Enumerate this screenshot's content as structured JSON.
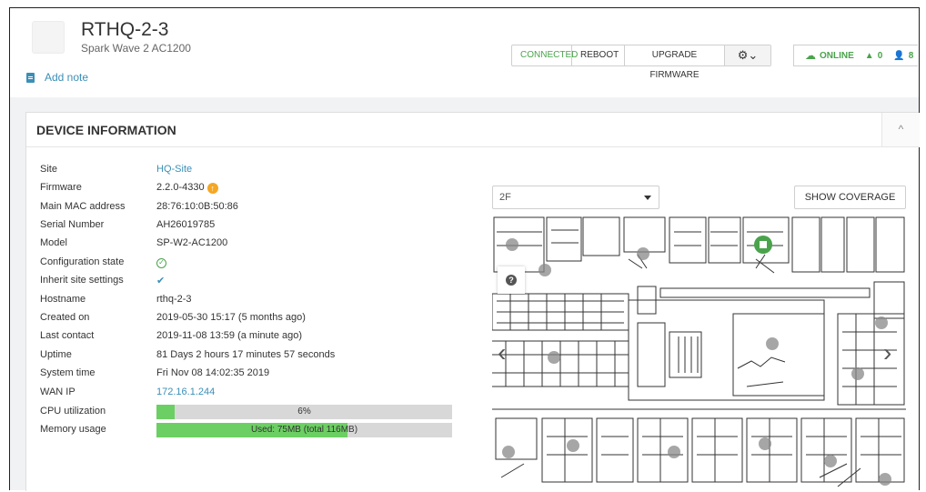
{
  "device": {
    "name": "RTHQ-2-3",
    "model_name": "Spark Wave 2 AC1200",
    "add_note": "Add note"
  },
  "actions": {
    "connected": "CONNECTED",
    "reboot": "REBOOT",
    "upgrade": "UPGRADE FIRMWARE",
    "gear": "⚙⌄"
  },
  "status": {
    "online": "ONLINE",
    "alerts": "0",
    "clients": "8"
  },
  "panel": {
    "title": "DEVICE INFORMATION",
    "collapse": "^"
  },
  "info": {
    "site": {
      "label": "Site",
      "value": "HQ-Site"
    },
    "firmware": {
      "label": "Firmware",
      "value": "2.2.0-4330"
    },
    "mac": {
      "label": "Main MAC address",
      "value": "28:76:10:0B:50:86"
    },
    "serial": {
      "label": "Serial Number",
      "value": "AH26019785"
    },
    "model": {
      "label": "Model",
      "value": "SP-W2-AC1200"
    },
    "config": {
      "label": "Configuration state"
    },
    "inherit": {
      "label": "Inherit site settings"
    },
    "hostname": {
      "label": "Hostname",
      "value": "rthq-2-3"
    },
    "created": {
      "label": "Created on",
      "value": "2019-05-30 15:17 (5 months ago)"
    },
    "last_contact": {
      "label": "Last contact",
      "value": "2019-11-08 13:59 (a minute ago)"
    },
    "uptime": {
      "label": "Uptime",
      "value": "81 Days 2 hours 17 minutes 57 seconds"
    },
    "system_time": {
      "label": "System time",
      "value": "Fri Nov 08 14:02:35 2019"
    },
    "wan_ip": {
      "label": "WAN IP",
      "value": "172.16.1.244"
    },
    "cpu": {
      "label": "CPU utilization",
      "text": "6%",
      "fraction": 0.06
    },
    "memory": {
      "label": "Memory usage",
      "text": "Used: 75MB (total 116MB)",
      "fraction": 0.647
    }
  },
  "map": {
    "floor": "2F",
    "show_coverage": "SHOW COVERAGE",
    "help": "?",
    "nav_left": "‹",
    "nav_right": "›"
  },
  "colors": {
    "accent": "#3a8fb7",
    "success": "#4aa34c",
    "bar_fill": "#6ccf63",
    "firmware_badge": "#f5a623"
  }
}
